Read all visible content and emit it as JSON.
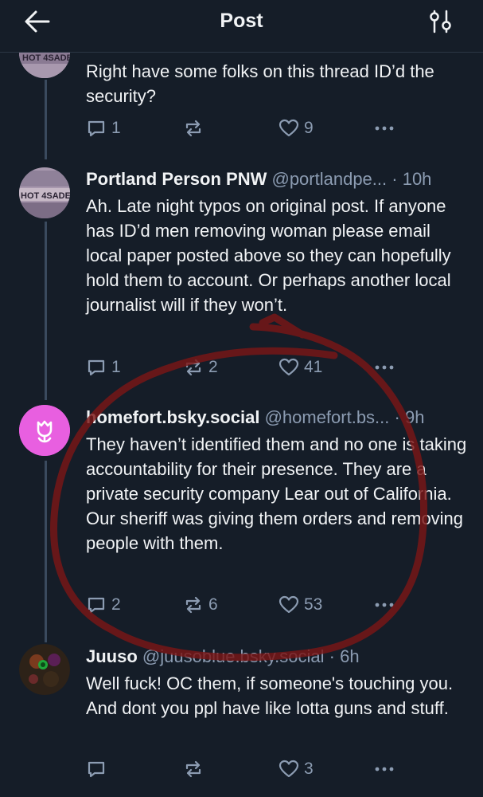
{
  "header": {
    "title": "Post",
    "back_icon": "arrow-left-icon",
    "filter_icon": "sliders-icon"
  },
  "posts": [
    {
      "name": "",
      "handle": "",
      "time": "",
      "text": "Right have some folks on this thread ID’d the security?",
      "replies": "1",
      "reposts": "",
      "likes": "9",
      "avatar_text": "HOT 4SADE"
    },
    {
      "name": "Portland Person PNW",
      "handle": "@portlandpe...",
      "time": "· 10h",
      "text": "Ah. Late night typos on original post.  If anyone has ID’d men removing woman please email local paper posted above so they can hopefully hold them to account. Or perhaps another local journalist will if they won’t.",
      "replies": "1",
      "reposts": "2",
      "likes": "41",
      "avatar_text": "HOT 4SADE"
    },
    {
      "name": "homefort.bsky.social",
      "handle": "@homefort.bs...",
      "time": "· 9h",
      "text": "They haven’t identified them and no one is taking accountability for their presence. They are a private security company Lear out of California. Our sheriff was giving them orders and removing people with them.",
      "replies": "2",
      "reposts": "6",
      "likes": "53",
      "avatar_icon": "tulip-icon"
    },
    {
      "name": "Juuso",
      "handle": "@juusoblue.bsky.social",
      "time": "· 6h",
      "text": "Well fuck! OC them, if someone's touching you. And dont you ppl have like lotta guns and stuff.",
      "replies": "",
      "reposts": "",
      "likes": "3"
    }
  ],
  "colors": {
    "background": "#151d28",
    "muted": "#8c9cb2",
    "annotation_circle": "#7a1616",
    "homefort_avatar": "#e85fe0"
  }
}
